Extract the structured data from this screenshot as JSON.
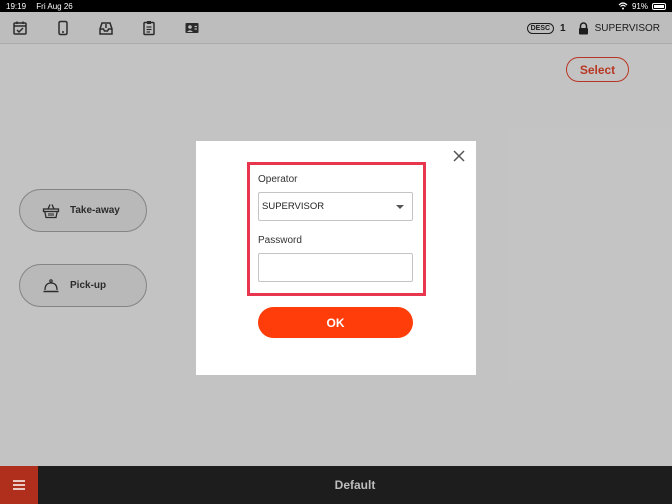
{
  "status_bar": {
    "time": "19:19",
    "date": "Fri Aug 26",
    "battery": "91%",
    "icons": [
      "wifi-icon",
      "battery-icon"
    ]
  },
  "toolbar": {
    "icons": [
      "calendar-check-icon",
      "mobile-phone-icon",
      "inbox-icon",
      "clipboard-icon",
      "user-card-icon"
    ],
    "desc_badge": "DESC",
    "desc_count": "1",
    "operator": "SUPERVISOR",
    "lock_icon": "lock-icon"
  },
  "select_button": {
    "label": "Select"
  },
  "order_types": [
    {
      "label": "Take-away",
      "icon": "basket-icon"
    },
    {
      "label": "Pick-up",
      "icon": "service-bell-icon"
    }
  ],
  "login_dialog": {
    "operator_label": "Operator",
    "operator_value": "SUPERVISOR",
    "password_label": "Password",
    "password_value": "",
    "ok_label": "OK",
    "close_icon": "close-icon"
  },
  "bottom_bar": {
    "title": "Default",
    "menu_icon": "hamburger-menu-icon"
  },
  "colors": {
    "accent": "#ff3d0a",
    "highlight": "#e8364e",
    "select_text": "#d7402a",
    "menu_bg": "#b02f1c"
  }
}
